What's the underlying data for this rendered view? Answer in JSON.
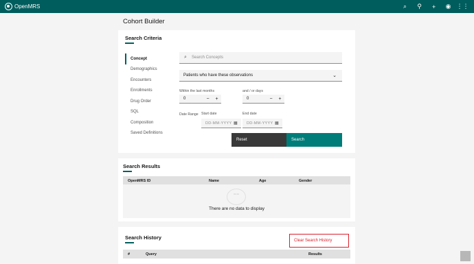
{
  "header": {
    "brand": "OpenMRS",
    "icons": [
      "search-icon",
      "user-search-icon",
      "add-icon",
      "user-icon",
      "app-switcher-icon"
    ],
    "icon_glyphs": [
      "⌕",
      "⚲",
      "+",
      "◉",
      "⋮⋮"
    ]
  },
  "page": {
    "title": "Cohort Builder"
  },
  "criteria": {
    "title": "Search Criteria",
    "tabs": [
      "Concept",
      "Demographics",
      "Encounters",
      "Enrollments",
      "Drug Order",
      "SQL",
      "Composition",
      "Saved Definitions"
    ],
    "search_placeholder": "Search Concepts",
    "dropdown_value": "Patients who have these observations",
    "within_label": "Within the last months",
    "within_value": "0",
    "days_label": "and / or days",
    "days_value": "0",
    "date_range_label": "Date Range",
    "start_label": "Start date",
    "end_label": "End date",
    "date_placeholder": "DD-MM-YYYY",
    "minus": "−",
    "plus": "+",
    "reset_label": "Reset",
    "search_label": "Search"
  },
  "results": {
    "title": "Search Results",
    "columns": [
      "OpenMRS ID",
      "Name",
      "Age",
      "Gender"
    ],
    "empty_text": "There are no data to display"
  },
  "history": {
    "title": "Search History",
    "clear_label": "Clear Search History",
    "columns": [
      "#",
      "Query",
      "Results"
    ]
  },
  "colors": {
    "brand": "#005d5d",
    "accent": "#007d79",
    "danger": "#da1e28"
  }
}
